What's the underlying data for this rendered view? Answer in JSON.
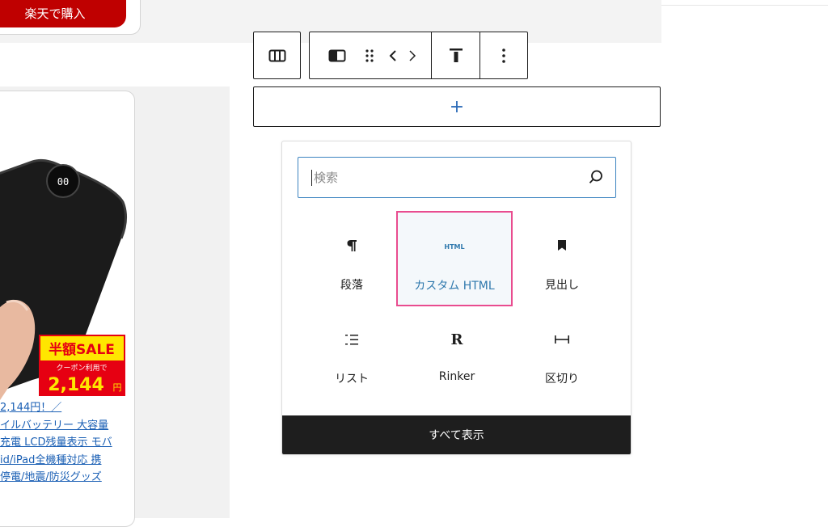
{
  "top_card": {
    "button_label": "楽天で購入"
  },
  "product": {
    "badge_title": "半額SALE",
    "badge_sub": "クーポン利用で",
    "badge_price": "2,144",
    "badge_unit": "円",
    "link_lines": [
      "2,144円！／",
      "イルバッテリー 大容量",
      "充電 LCD残量表示 モバ",
      "id/iPad全機種対応 携",
      "停電/地震/防災グッズ"
    ]
  },
  "toolbar": {
    "parent_icon": "columns-icon",
    "block_icon": "column-icon",
    "drag_icon": "drag-handle-icon",
    "move_icon": "chevron-left-right-icon",
    "align_icon": "align-top-icon",
    "options_icon": "more-vertical-icon"
  },
  "appender": {
    "label": "+"
  },
  "inserter": {
    "search_placeholder": "検索",
    "blocks": [
      {
        "label": "段落",
        "icon": "paragraph-icon"
      },
      {
        "label": "カスタム HTML",
        "icon_text": "HTML",
        "icon": "html-icon",
        "selected": true
      },
      {
        "label": "見出し",
        "icon": "bookmark-icon"
      },
      {
        "label": "リスト",
        "icon": "list-icon"
      },
      {
        "label": "Rinker",
        "icon_text": "R",
        "icon": "rinker-icon"
      },
      {
        "label": "区切り",
        "icon": "separator-icon"
      }
    ],
    "show_all_label": "すべて表示"
  },
  "colors": {
    "rakuten_red": "#bf0000",
    "accent_blue": "#2e78ad",
    "selection_pink": "#e94c8f",
    "dark": "#1e1e1e"
  }
}
